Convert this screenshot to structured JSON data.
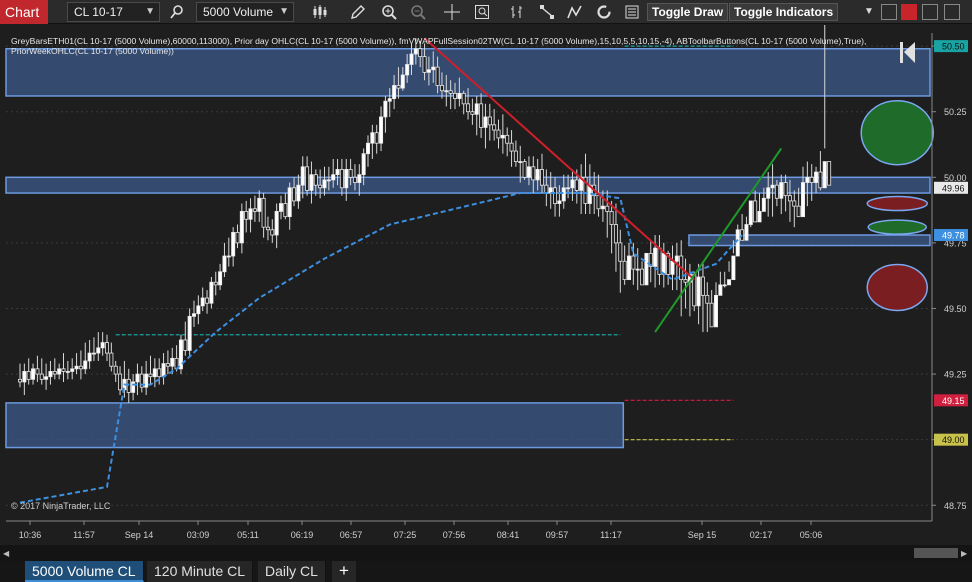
{
  "toolbar": {
    "chart_label": "Chart",
    "instrument": "CL 10-17",
    "bar_type": "5000 Volume",
    "toggle_draw": "Toggle Draw",
    "toggle_indicators": "Toggle Indicators",
    "icons": [
      "search-icon",
      "bar-style-icon",
      "pencil-icon",
      "zoom-in-icon",
      "zoom-out-icon",
      "crosshair-icon",
      "data-box-icon",
      "indicators-icon",
      "strategies-icon",
      "drawing-tools-icon",
      "reload-icon",
      "properties-icon"
    ],
    "colors": {
      "chart_tab": "#c0282d",
      "active_tab": "#1f4f78"
    }
  },
  "chart": {
    "indicator_label": "GreyBarsETH01(CL 10-17 (5000 Volume),60000,113000), Prior day OHLC(CL 10-17 (5000 Volume)), fmVWAPFullSession02TW(CL 10-17 (5000 Volume),15,10,5,5,10,15,-4), ABToolbarButtons(CL 10-17 (5000 Volume),True), PriorWeekOHLC(CL 10-17 (5000 Volume))",
    "copyright": "© 2017 NinjaTrader, LLC",
    "colors": {
      "background": "#1e1e1e",
      "zone_fill": "#3c5a8a",
      "zone_border": "#6d9ae0",
      "trend_red": "#d01f2a",
      "trend_green": "#1f9a2a",
      "vwap": "#3d8fe0"
    }
  },
  "chart_data": {
    "type": "candlestick",
    "price_axis": {
      "ticks": [
        "50.50",
        "50.25",
        "50.00",
        "49.75",
        "49.50",
        "49.25",
        "49.00",
        "48.75"
      ],
      "range": [
        48.69,
        50.55
      ],
      "markers": [
        {
          "label": "50.50",
          "value": 50.5,
          "color": "#1aa3a3"
        },
        {
          "label": "49.96",
          "value": 49.96,
          "color": "#e9e9e9"
        },
        {
          "label": "49.78",
          "value": 49.78,
          "color": "#3d8fe0"
        },
        {
          "label": "49.15",
          "value": 49.15,
          "color": "#d01f3f"
        },
        {
          "label": "49.00",
          "value": 49.0,
          "color": "#c8c24a"
        }
      ]
    },
    "time_axis": {
      "labels": [
        "10:36",
        "11:57",
        "Sep 14",
        "03:09",
        "05:11",
        "06:19",
        "06:57",
        "07:25",
        "07:56",
        "08:41",
        "09:57",
        "11:17",
        "Sep 15",
        "02:17",
        "05:06"
      ]
    },
    "candles": {
      "o": [
        49.23,
        49.22,
        49.26,
        49.23,
        49.27,
        49.25,
        49.23,
        49.24,
        49.26,
        49.25,
        49.27,
        49.26,
        49.26,
        49.27,
        49.28,
        49.27,
        49.3,
        49.33,
        49.33,
        49.35,
        49.37,
        49.33,
        49.28,
        49.25,
        49.19,
        49.23,
        49.18,
        49.22,
        49.25,
        49.2,
        49.25,
        49.24,
        49.27,
        49.24,
        49.29,
        49.28,
        49.31,
        49.27,
        49.38,
        49.34,
        49.47,
        49.48,
        49.51,
        49.54,
        49.52,
        49.6,
        49.59,
        49.64,
        49.7,
        49.7,
        49.79,
        49.75,
        49.87,
        49.84,
        49.88,
        49.87,
        49.92,
        49.81,
        49.8,
        49.78,
        49.87,
        49.9,
        49.85,
        49.96,
        49.91,
        49.97,
        50.04,
        49.95,
        50.01,
        49.97,
        49.96,
        49.99,
        49.99,
        50.01,
        50.03,
        49.96,
        50.03,
        50.0,
        49.98,
        50.01,
        50.09,
        50.13,
        50.17,
        50.13,
        50.23,
        50.29,
        50.3,
        50.35,
        50.34,
        50.39,
        50.43,
        50.47,
        50.49,
        50.46,
        50.4,
        50.41,
        50.42,
        50.35,
        50.33,
        50.33,
        50.32,
        50.3,
        50.32,
        50.28,
        50.25,
        50.24,
        50.28,
        50.19,
        50.23,
        50.2,
        50.18,
        50.15,
        50.16,
        50.13,
        50.1,
        50.06,
        50.06,
        50.0,
        50.04,
        49.99,
        50.03,
        49.97,
        49.94,
        49.96,
        49.9,
        49.91,
        49.96,
        49.96,
        49.99,
        49.95,
        50.0,
        49.9,
        49.97,
        49.93,
        49.88,
        49.89,
        49.87,
        49.82,
        49.75,
        49.68,
        49.61,
        49.7,
        49.65,
        49.65,
        49.59,
        49.71,
        49.66,
        49.73,
        49.63,
        49.71,
        49.63,
        49.68,
        49.7,
        49.61,
        49.6,
        49.63,
        49.51,
        49.62,
        49.55,
        49.52,
        49.43,
        49.55,
        49.59,
        49.59,
        49.61,
        49.7,
        49.8,
        49.76,
        49.82,
        49.91,
        49.83,
        49.87,
        49.92,
        49.96,
        49.97,
        49.92,
        49.98,
        49.93,
        49.91,
        49.89,
        49.85,
        49.98,
        50.0,
        49.98,
        50.02,
        49.96,
        50.06
      ],
      "h": [
        49.29,
        49.29,
        49.31,
        49.29,
        49.32,
        49.31,
        49.29,
        49.3,
        49.31,
        49.29,
        49.33,
        49.3,
        49.31,
        49.33,
        49.34,
        49.37,
        49.38,
        49.39,
        49.41,
        49.41,
        49.4,
        49.37,
        49.3,
        49.28,
        49.3,
        49.27,
        49.25,
        49.29,
        49.28,
        49.3,
        49.32,
        49.31,
        49.31,
        49.33,
        49.34,
        49.35,
        49.36,
        49.4,
        49.45,
        49.5,
        49.53,
        49.55,
        49.58,
        49.57,
        49.62,
        49.64,
        49.67,
        49.75,
        49.77,
        49.81,
        49.82,
        49.9,
        49.91,
        49.92,
        49.93,
        49.95,
        49.94,
        49.85,
        49.84,
        49.9,
        49.93,
        49.94,
        49.98,
        50.0,
        50.01,
        50.08,
        50.08,
        50.06,
        50.03,
        50.03,
        50.04,
        50.04,
        50.07,
        50.07,
        50.07,
        50.07,
        50.07,
        50.05,
        50.05,
        50.11,
        50.16,
        50.2,
        50.2,
        50.27,
        50.31,
        50.34,
        50.39,
        50.42,
        50.42,
        50.47,
        50.51,
        50.53,
        50.52,
        50.51,
        50.46,
        50.48,
        50.46,
        50.4,
        50.39,
        50.37,
        50.36,
        50.38,
        50.33,
        50.34,
        50.3,
        50.31,
        50.32,
        50.28,
        50.28,
        50.26,
        50.22,
        50.24,
        50.19,
        50.18,
        50.14,
        50.12,
        50.07,
        50.08,
        50.08,
        50.07,
        50.09,
        50.03,
        50.02,
        50.0,
        49.97,
        50.01,
        50.01,
        50.03,
        50.03,
        50.05,
        50.09,
        50.05,
        50.02,
        50.01,
        49.95,
        49.95,
        49.91,
        49.9,
        49.8,
        49.74,
        49.75,
        49.75,
        49.73,
        49.68,
        49.71,
        49.76,
        49.78,
        49.78,
        49.75,
        49.72,
        49.74,
        49.75,
        49.76,
        49.69,
        49.67,
        49.64,
        49.67,
        49.68,
        49.6,
        49.57,
        49.6,
        49.64,
        49.64,
        49.68,
        49.76,
        49.82,
        49.86,
        49.85,
        49.91,
        49.95,
        49.94,
        49.96,
        50.02,
        50.05,
        49.99,
        50.01,
        50.01,
        49.99,
        49.95,
        49.96,
        50.04,
        50.06,
        50.05,
        50.04,
        50.1,
        50.11
      ],
      "l": [
        49.2,
        49.17,
        49.21,
        49.21,
        49.22,
        49.21,
        49.19,
        49.21,
        49.23,
        49.23,
        49.22,
        49.23,
        49.23,
        49.25,
        49.23,
        49.25,
        49.27,
        49.3,
        49.3,
        49.32,
        49.3,
        49.26,
        49.22,
        49.17,
        49.16,
        49.14,
        49.15,
        49.17,
        49.18,
        49.17,
        49.21,
        49.2,
        49.21,
        49.21,
        49.25,
        49.25,
        49.26,
        49.25,
        49.32,
        49.32,
        49.43,
        49.44,
        49.49,
        49.48,
        49.5,
        49.55,
        49.57,
        49.62,
        49.66,
        49.66,
        49.73,
        49.71,
        49.79,
        49.79,
        49.83,
        49.83,
        49.77,
        49.76,
        49.75,
        49.73,
        49.84,
        49.84,
        49.8,
        49.89,
        49.88,
        49.92,
        49.93,
        49.9,
        49.93,
        49.92,
        49.93,
        49.95,
        49.96,
        49.97,
        49.93,
        49.91,
        49.97,
        49.95,
        49.93,
        49.97,
        50.04,
        50.07,
        50.09,
        50.1,
        50.17,
        50.23,
        50.26,
        50.3,
        50.33,
        50.36,
        50.39,
        50.43,
        50.42,
        50.37,
        50.35,
        50.36,
        50.32,
        50.3,
        50.27,
        50.26,
        50.26,
        50.27,
        50.24,
        50.22,
        50.2,
        50.16,
        50.15,
        50.11,
        50.14,
        50.14,
        50.11,
        50.09,
        50.08,
        50.04,
        50.04,
        49.98,
        49.99,
        49.97,
        49.94,
        49.95,
        49.94,
        49.89,
        49.88,
        49.85,
        49.85,
        49.88,
        49.92,
        49.91,
        49.9,
        49.86,
        49.86,
        49.86,
        49.86,
        49.85,
        49.83,
        49.77,
        49.71,
        49.64,
        49.56,
        49.59,
        49.63,
        49.59,
        49.57,
        49.59,
        49.63,
        49.6,
        49.58,
        49.59,
        49.58,
        49.59,
        49.57,
        49.57,
        49.47,
        49.5,
        49.47,
        49.49,
        49.44,
        49.41,
        49.41,
        49.52,
        49.53,
        49.55,
        49.58,
        49.64,
        49.71,
        49.7,
        49.8,
        49.78,
        49.81,
        49.83,
        49.87,
        49.88,
        49.85,
        49.85,
        49.89,
        49.86,
        49.87,
        49.83,
        49.81,
        49.86,
        49.91,
        49.89,
        49.91,
        49.94,
        49.95
      ],
      "c": [
        49.22,
        49.26,
        49.23,
        49.27,
        49.25,
        49.23,
        49.24,
        49.26,
        49.25,
        49.27,
        49.26,
        49.26,
        49.27,
        49.28,
        49.27,
        49.3,
        49.33,
        49.33,
        49.35,
        49.37,
        49.33,
        49.28,
        49.25,
        49.19,
        49.23,
        49.18,
        49.22,
        49.25,
        49.2,
        49.25,
        49.24,
        49.27,
        49.24,
        49.29,
        49.28,
        49.31,
        49.27,
        49.38,
        49.34,
        49.47,
        49.48,
        49.51,
        49.54,
        49.52,
        49.6,
        49.59,
        49.64,
        49.7,
        49.7,
        49.79,
        49.75,
        49.87,
        49.84,
        49.88,
        49.87,
        49.92,
        49.81,
        49.8,
        49.78,
        49.87,
        49.9,
        49.85,
        49.96,
        49.91,
        49.97,
        50.04,
        49.95,
        50.01,
        49.97,
        49.96,
        49.99,
        49.99,
        50.01,
        50.03,
        49.96,
        50.03,
        50.0,
        49.98,
        50.01,
        50.09,
        50.13,
        50.17,
        50.13,
        50.23,
        50.29,
        50.3,
        50.35,
        50.34,
        50.39,
        50.43,
        50.47,
        50.49,
        50.46,
        50.4,
        50.41,
        50.42,
        50.35,
        50.33,
        50.33,
        50.32,
        50.3,
        50.32,
        50.28,
        50.25,
        50.24,
        50.28,
        50.19,
        50.23,
        50.2,
        50.18,
        50.15,
        50.16,
        50.13,
        50.1,
        50.06,
        50.06,
        50.0,
        50.04,
        49.99,
        50.03,
        49.97,
        49.94,
        49.96,
        49.9,
        49.91,
        49.96,
        49.96,
        49.99,
        49.95,
        50.0,
        49.9,
        49.97,
        49.93,
        49.88,
        49.89,
        49.87,
        49.82,
        49.75,
        49.68,
        49.61,
        49.7,
        49.65,
        49.65,
        49.59,
        49.71,
        49.66,
        49.73,
        49.63,
        49.71,
        49.63,
        49.68,
        49.7,
        49.61,
        49.6,
        49.63,
        49.51,
        49.62,
        49.55,
        49.52,
        49.43,
        49.55,
        49.59,
        49.59,
        49.61,
        49.7,
        49.8,
        49.76,
        49.82,
        49.91,
        49.83,
        49.87,
        49.92,
        49.96,
        49.97,
        49.92,
        49.98,
        49.93,
        49.91,
        49.89,
        49.85,
        49.98,
        50.0,
        49.98,
        50.02,
        49.96,
        50.06,
        49.97
      ]
    },
    "zones": [
      {
        "from_bar": 0,
        "to_bar": 188,
        "low": 50.31,
        "high": 50.49
      },
      {
        "from_bar": 0,
        "to_bar": 188,
        "low": 49.94,
        "high": 50.0
      },
      {
        "from_bar": 157,
        "to_bar": 188,
        "low": 49.74,
        "high": 49.78
      },
      {
        "from_bar": 0,
        "to_bar": 138,
        "low": 48.97,
        "high": 49.14
      }
    ],
    "levels": [
      {
        "value": 50.5,
        "from_bar": 139,
        "to_bar": 164,
        "color": "#1aa3a3"
      },
      {
        "value": 49.4,
        "from_bar": 22,
        "to_bar": 138,
        "color": "#1aa3a3"
      },
      {
        "value": 49.15,
        "from_bar": 139,
        "to_bar": 164,
        "color": "#d01f3f"
      },
      {
        "value": 49.0,
        "from_bar": 139,
        "to_bar": 164,
        "color": "#c8c24a"
      }
    ],
    "trendlines": [
      {
        "from": [
          93,
          50.53
        ],
        "to": [
          155,
          49.61
        ],
        "color": "#d01f2a"
      },
      {
        "from": [
          146,
          49.41
        ],
        "to": [
          175,
          50.11
        ],
        "color": "#1f9a2a"
      }
    ],
    "vwap": [
      {
        "bar": 0,
        "value": 48.76
      },
      {
        "bar": 20,
        "value": 48.82
      },
      {
        "bar": 24,
        "value": 49.21
      },
      {
        "bar": 30,
        "value": 49.21
      },
      {
        "bar": 36,
        "value": 49.27
      },
      {
        "bar": 45,
        "value": 49.41
      },
      {
        "bar": 55,
        "value": 49.54
      },
      {
        "bar": 70,
        "value": 49.69
      },
      {
        "bar": 85,
        "value": 49.82
      },
      {
        "bar": 100,
        "value": 49.88
      },
      {
        "bar": 115,
        "value": 49.94
      },
      {
        "bar": 130,
        "value": 49.94
      },
      {
        "bar": 138,
        "value": 49.92
      },
      {
        "bar": 141,
        "value": 49.71
      },
      {
        "bar": 150,
        "value": 49.61
      },
      {
        "bar": 160,
        "value": 49.67
      },
      {
        "bar": 166,
        "value": 49.78
      }
    ],
    "ellipses": [
      {
        "bar": 175,
        "value": 50.17,
        "color": "#1e6b2a"
      },
      {
        "bar": 175,
        "value": 49.9,
        "color": "#7a1e22"
      },
      {
        "bar": 175,
        "value": 49.81,
        "color": "#1e6b2a"
      },
      {
        "bar": 175,
        "value": 49.58,
        "color": "#7a1e22"
      }
    ]
  },
  "tabs": [
    {
      "label": "5000 Volume CL",
      "active": true
    },
    {
      "label": "120 Minute CL",
      "active": false
    },
    {
      "label": "Daily CL",
      "active": false
    }
  ],
  "tab_add": "+"
}
